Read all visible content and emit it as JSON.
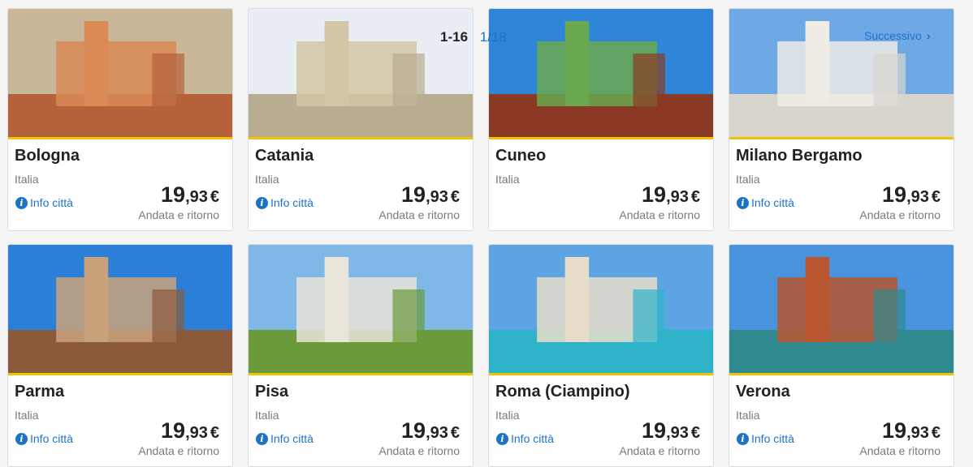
{
  "pager": {
    "range": "1-16",
    "more": "1/18",
    "next_label": "Successivo"
  },
  "common": {
    "info_label": "Info città",
    "trip_label": "Andata e ritorno",
    "price_int": "19",
    "price_dec": ",93",
    "currency": "€"
  },
  "cards": [
    {
      "city": "Bologna",
      "country": "Italia",
      "has_info": true,
      "sky": "#c9b79a",
      "ground": "#b5613a",
      "accent": "#d98a55"
    },
    {
      "city": "Catania",
      "country": "Italia",
      "has_info": true,
      "sky": "#e8eef3",
      "ground": "#b8ad92",
      "accent": "#d2c6a6"
    },
    {
      "city": "Cuneo",
      "country": "Italia",
      "has_info": false,
      "sky": "#2f86d8",
      "ground": "#8a3a24",
      "accent": "#6aa84f"
    },
    {
      "city": "Milano Bergamo",
      "country": "Italia",
      "has_info": true,
      "sky": "#6ea9e6",
      "ground": "#d8d5cf",
      "accent": "#efece6"
    },
    {
      "city": "Parma",
      "country": "Italia",
      "has_info": true,
      "sky": "#2b7fd6",
      "ground": "#8b5a3a",
      "accent": "#c9a27b"
    },
    {
      "city": "Pisa",
      "country": "Italia",
      "has_info": true,
      "sky": "#7fb7e6",
      "ground": "#6b9a3b",
      "accent": "#e9e5da"
    },
    {
      "city": "Roma (Ciampino)",
      "country": "Italia",
      "has_info": true,
      "sky": "#5ea4e3",
      "ground": "#2fb3c9",
      "accent": "#e6ddc9"
    },
    {
      "city": "Verona",
      "country": "Italia",
      "has_info": true,
      "sky": "#4a94dd",
      "ground": "#2f8a8f",
      "accent": "#b9562f"
    }
  ]
}
